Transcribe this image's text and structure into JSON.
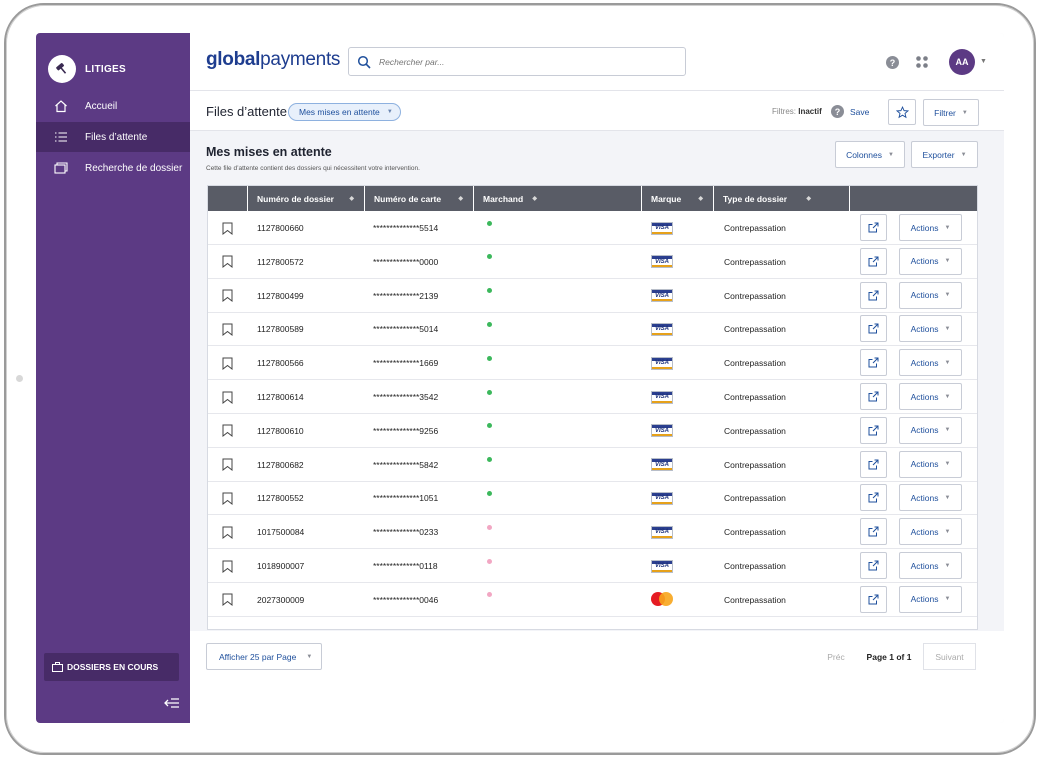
{
  "sidebar": {
    "title": "LITIGES",
    "items": [
      {
        "label": "Accueil",
        "icon": "home-icon"
      },
      {
        "label": "Files d’attente",
        "icon": "list-icon",
        "active": true
      },
      {
        "label": "Recherche de dossier",
        "icon": "folders-icon"
      }
    ],
    "bottom_button": "DOSSIERS EN COURS"
  },
  "header": {
    "brand_bold": "global",
    "brand_light": "payments",
    "search_placeholder": "Rechercher par...",
    "avatar_initials": "AA"
  },
  "toolbar": {
    "page_title": "Files d’attente",
    "queue_pill": "Mes mises en attente",
    "filters_prefix": "Filtres: ",
    "filters_value": "Inactif",
    "save_label": "Save",
    "filter_button": "Filtrer"
  },
  "main": {
    "title": "Mes mises en attente",
    "description": "Cette file d’attente contient des dossiers qui nécessitent votre intervention.",
    "columns_button": "Colonnes",
    "export_button": "Exporter"
  },
  "table": {
    "headers": [
      "Numéro de dossier",
      "Numéro de carte",
      "Marchand",
      "Marque",
      "Type de dossier"
    ],
    "action_label": "Actions",
    "rows": [
      {
        "dossier": "1127800660",
        "carte": "**************5514",
        "dot": "#3cb85c",
        "marque": "VISA",
        "type": "Contrepassation"
      },
      {
        "dossier": "1127800572",
        "carte": "**************0000",
        "dot": "#3cb85c",
        "marque": "VISA",
        "type": "Contrepassation"
      },
      {
        "dossier": "1127800499",
        "carte": "**************2139",
        "dot": "#3cb85c",
        "marque": "VISA",
        "type": "Contrepassation"
      },
      {
        "dossier": "1127800589",
        "carte": "**************5014",
        "dot": "#3cb85c",
        "marque": "VISA",
        "type": "Contrepassation"
      },
      {
        "dossier": "1127800566",
        "carte": "**************1669",
        "dot": "#3cb85c",
        "marque": "VISA",
        "type": "Contrepassation"
      },
      {
        "dossier": "1127800614",
        "carte": "**************3542",
        "dot": "#3cb85c",
        "marque": "VISA",
        "type": "Contrepassation"
      },
      {
        "dossier": "1127800610",
        "carte": "**************9256",
        "dot": "#3cb85c",
        "marque": "VISA",
        "type": "Contrepassation"
      },
      {
        "dossier": "1127800682",
        "carte": "**************5842",
        "dot": "#3cb85c",
        "marque": "VISA",
        "type": "Contrepassation"
      },
      {
        "dossier": "1127800552",
        "carte": "**************1051",
        "dot": "#3cb85c",
        "marque": "VISA",
        "type": "Contrepassation"
      },
      {
        "dossier": "1017500084",
        "carte": "**************0233",
        "dot": "#f2a7c3",
        "marque": "VISA",
        "type": "Contrepassation"
      },
      {
        "dossier": "1018900007",
        "carte": "**************0118",
        "dot": "#f2a7c3",
        "marque": "VISA",
        "type": "Contrepassation"
      },
      {
        "dossier": "2027300009",
        "carte": "**************0046",
        "dot": "#f2a7c3",
        "marque": "Mastercard",
        "type": "Contrepassation"
      }
    ]
  },
  "pagination": {
    "per_page": "Afficher 25 par Page",
    "prev": "Préc",
    "page_label": "Page 1 of 1",
    "next": "Suivant"
  },
  "colors": {
    "sidebar": "#5c3a84",
    "brand_blue": "#1e3d8f",
    "link_blue": "#1e4f9c",
    "table_header": "#595c66"
  }
}
